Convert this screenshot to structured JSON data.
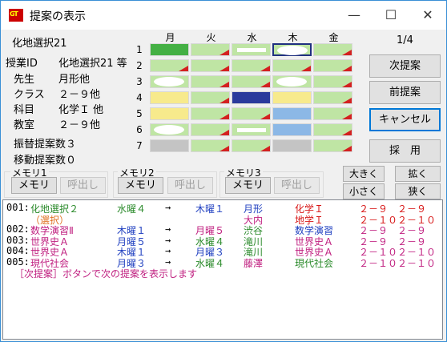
{
  "window": {
    "title": "提案の表示",
    "app_icon_text": "GT",
    "minimize": "—",
    "maximize": "☐",
    "close": "✕"
  },
  "info": {
    "heading": "化地選択21",
    "class_id_label": "授業ID",
    "class_id_value": "化地選択21 等",
    "teacher_label": "先生",
    "teacher_value": "月形他",
    "class_label": "クラス",
    "class_value": "２－９他",
    "subject_label": "科目",
    "subject_value": "化学Ｉ 他",
    "room_label": "教室",
    "room_value": "２－９他",
    "swap_count": "振替提案数３",
    "move_count": "移動提案数０"
  },
  "timetable": {
    "days": [
      "月",
      "火",
      "水",
      "木",
      "金"
    ],
    "periods": [
      "1",
      "2",
      "3",
      "4",
      "5",
      "6",
      "7"
    ],
    "cells": [
      [
        "green-dark",
        "tri",
        "bar",
        "oval-sel",
        "tri"
      ],
      [
        "tri",
        "tri",
        "tri",
        "tri",
        "tri"
      ],
      [
        "oval",
        "tri",
        "tri",
        "oval",
        "tri"
      ],
      [
        "yellow",
        "tri",
        "navy",
        "yellow",
        "tri"
      ],
      [
        "yellow",
        "tri",
        "tri",
        "blue",
        "tri"
      ],
      [
        "oval",
        "tri",
        "bar",
        "blue",
        "tri"
      ],
      [
        "gray",
        "tri",
        "tri",
        "gray",
        "tri"
      ]
    ]
  },
  "page_indicator": "1/4",
  "buttons": {
    "next": "次提案",
    "prev": "前提案",
    "cancel": "キャンセル",
    "adopt": "採　用"
  },
  "memory": [
    {
      "title": "メモリ1",
      "store": "メモリ",
      "recall": "呼出し"
    },
    {
      "title": "メモリ2",
      "store": "メモリ",
      "recall": "呼出し"
    },
    {
      "title": "メモリ3",
      "store": "メモリ",
      "recall": "呼出し"
    }
  ],
  "size_buttons": {
    "larger": "大きく",
    "smaller": "小さく",
    "widen": "拡く",
    "narrow": "狭く"
  },
  "proposals": [
    {
      "id": "001:",
      "subject": "化地選択２",
      "from": "水曜４",
      "arrow": "→",
      "to": "木曜１",
      "teacher": "月形",
      "subj2": "化学Ｉ",
      "cls": "２－９　２－９"
    },
    {
      "id": "",
      "subject": "（選択）",
      "from": "",
      "arrow": "",
      "to": "",
      "teacher": "大内",
      "subj2": "地学Ｉ",
      "cls": "２－１０２－１０"
    },
    {
      "id": "002:",
      "subject": "数学演習Ⅱ",
      "from": "木曜１",
      "arrow": "→",
      "to": "月曜５",
      "teacher": "渋谷",
      "subj2": "数学演習",
      "cls": "２－９　２－９"
    },
    {
      "id": "003:",
      "subject": "世界史Ａ",
      "from": "月曜５",
      "arrow": "→",
      "to": "水曜４",
      "teacher": "滝川",
      "subj2": "世界史Ａ",
      "cls": "２－９　２－９"
    },
    {
      "id": "004:",
      "subject": "世界史Ａ",
      "from": "木曜１",
      "arrow": "→",
      "to": "月曜３",
      "teacher": "滝川",
      "subj2": "世界史Ａ",
      "cls": "２－１０２－１０"
    },
    {
      "id": "005:",
      "subject": "現代社会",
      "from": "月曜３",
      "arrow": "→",
      "to": "水曜４",
      "teacher": "藤澤",
      "subj2": "現代社会",
      "cls": "２－１０２－１０"
    }
  ],
  "hint": "［次提案］ボタンで次の提案を表示します"
}
